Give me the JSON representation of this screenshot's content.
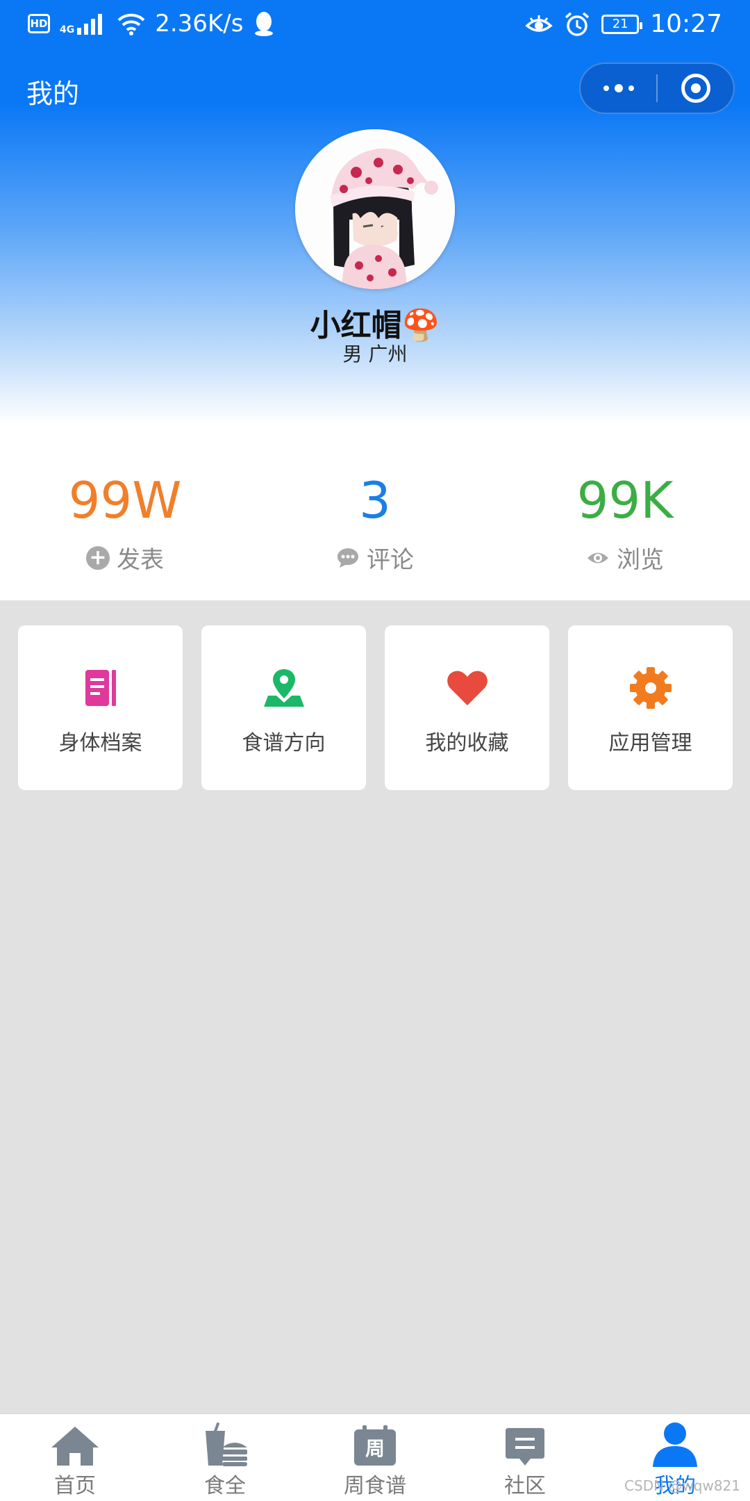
{
  "status_bar": {
    "hd_badge": "HD",
    "network": "4G",
    "speed": "2.36K/s",
    "battery": "21",
    "time": "10:27"
  },
  "nav": {
    "title": "我的",
    "more_icon": "more-dots-icon",
    "close_icon": "target-icon"
  },
  "profile": {
    "name": "小红帽",
    "name_emoji": "🍄",
    "meta": "男 广州"
  },
  "stats": [
    {
      "value": "99W",
      "label": "发表",
      "color": "#f07f2a",
      "icon": "plus-circle-icon"
    },
    {
      "value": "3",
      "label": "评论",
      "color": "#1a7fe5",
      "icon": "comment-icon"
    },
    {
      "value": "99K",
      "label": "浏览",
      "color": "#3cad45",
      "icon": "eye-icon"
    }
  ],
  "menu": [
    {
      "label": "身体档案",
      "icon": "notebook-icon",
      "color": "#e0399b"
    },
    {
      "label": "食谱方向",
      "icon": "map-pin-icon",
      "color": "#1bb868"
    },
    {
      "label": "我的收藏",
      "icon": "heart-icon",
      "color": "#e84a3e"
    },
    {
      "label": "应用管理",
      "icon": "gear-icon",
      "color": "#f07c1f"
    }
  ],
  "tabbar": {
    "items": [
      {
        "label": "首页",
        "icon": "home-icon"
      },
      {
        "label": "食全",
        "icon": "drink-burger-icon"
      },
      {
        "label": "周食谱",
        "icon": "calendar-icon",
        "icon_text": "周"
      },
      {
        "label": "社区",
        "icon": "chat-icon"
      },
      {
        "label": "我的",
        "icon": "user-icon"
      }
    ],
    "active_index": 4,
    "active_color": "#0a78f5",
    "inactive_color": "#7a8691"
  },
  "watermark": "CSDN @wqw821"
}
